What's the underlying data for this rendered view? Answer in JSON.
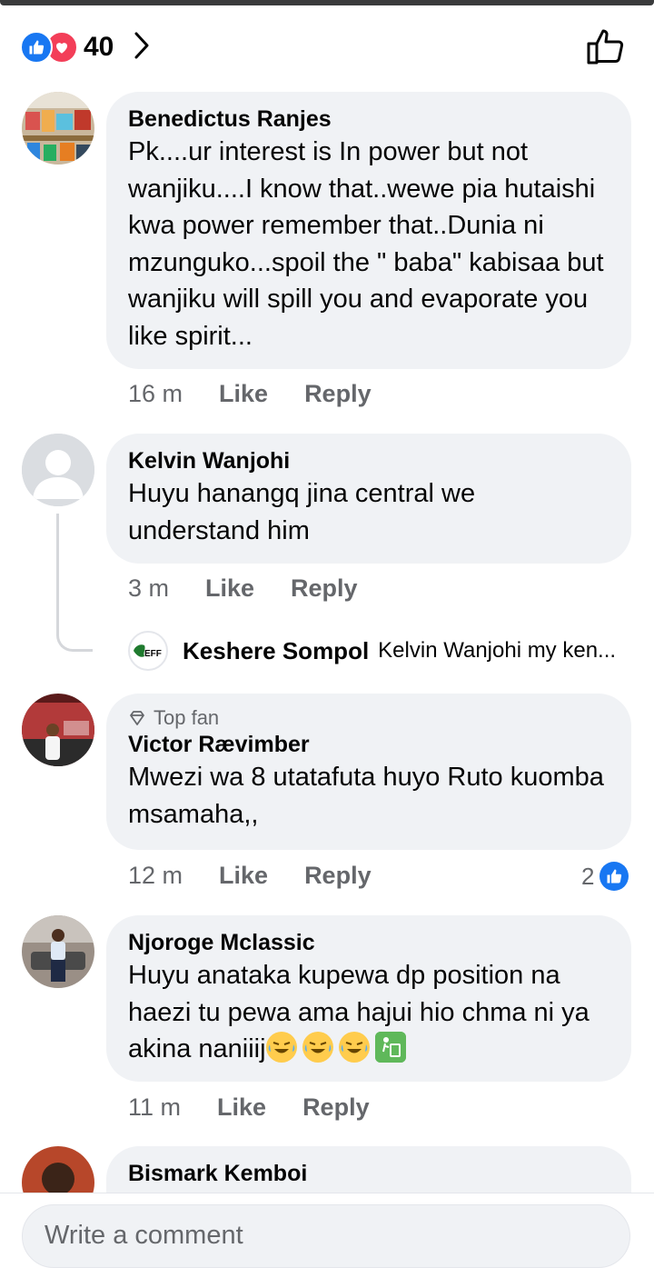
{
  "reactions": {
    "count": "40"
  },
  "comments": [
    {
      "author": "Benedictus Ranjes",
      "text": "Pk....ur interest is In power but not wanjiku....I know that..wewe pia hutaishi kwa power remember that..Dunia ni mzunguko...spoil the \" baba\" kabisaa but wanjiku will spill you and evaporate you like spirit...",
      "time": "16 m",
      "like": "Like",
      "reply": "Reply"
    },
    {
      "author": "Kelvin Wanjohi",
      "text": "Huyu hanangq jina central we understand him",
      "time": "3 m",
      "like": "Like",
      "reply": "Reply",
      "reply_preview": {
        "author": "Keshere Sompol",
        "text": "Kelvin Wanjohi my ken...",
        "avatar_text": "EFF"
      }
    },
    {
      "badge": "Top fan",
      "author": "Victor Rævimber",
      "text": "Mwezi wa 8 utatafuta huyo Ruto kuomba msamaha,,",
      "time": "12 m",
      "like": "Like",
      "reply": "Reply",
      "reaction_count": "2"
    },
    {
      "author": "Njoroge Mclassic",
      "text": "Huyu anataka kupewa dp position na haezi tu pewa ama hajui hio chma ni ya akina naniiij",
      "time": "11 m",
      "like": "Like",
      "reply": "Reply"
    },
    {
      "author": "Bismark Kemboi"
    }
  ],
  "composer": {
    "placeholder": "Write a comment"
  },
  "colors": {
    "like_blue": "#1877f2",
    "love_red": "#f33e58",
    "bubble_gray": "#f0f2f5",
    "meta_gray": "#65676b"
  }
}
